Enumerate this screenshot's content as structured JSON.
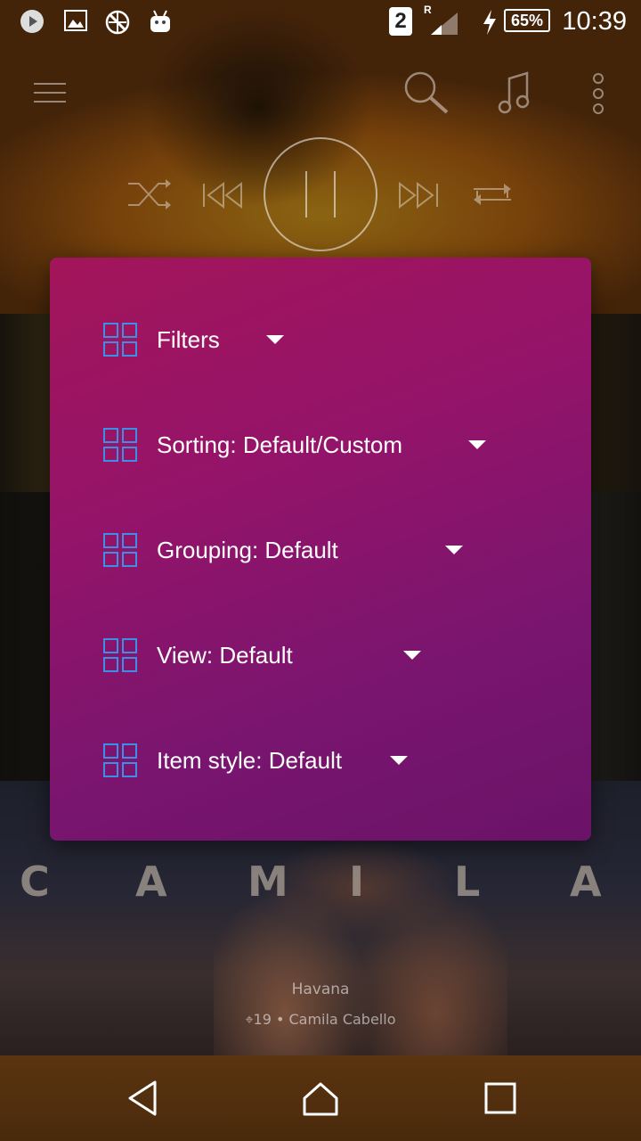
{
  "status_bar": {
    "icons": [
      "play-icon",
      "image-icon",
      "no-network-icon",
      "android-icon"
    ],
    "sim_slot": "2",
    "roaming": "R",
    "battery_percent": "65%",
    "time": "10:39"
  },
  "toolbar": {
    "icons": [
      "menu-icon",
      "search-icon",
      "music-note-icon",
      "more-vert-icon"
    ]
  },
  "player": {
    "icons": [
      "shuffle-icon",
      "previous-icon",
      "pause-icon",
      "next-icon",
      "repeat-icon"
    ]
  },
  "menu": {
    "items": [
      {
        "label": "Filters",
        "icon": "grid-icon"
      },
      {
        "label": "Sorting: Default/Custom",
        "icon": "grid-icon"
      },
      {
        "label": "Grouping: Default",
        "icon": "grid-icon"
      },
      {
        "label": "View: Default",
        "icon": "grid-icon"
      },
      {
        "label": "Item style: Default",
        "icon": "grid-icon"
      }
    ]
  },
  "album": {
    "cover_text": [
      "C",
      "A",
      "M",
      "I",
      "L",
      "A"
    ],
    "track_title": "Havana",
    "track_meta": "⌖19 • Camila Cabello"
  },
  "nav_bar": {
    "icons": [
      "back-icon",
      "home-icon",
      "recents-icon"
    ]
  },
  "colors": {
    "menu_gradient_start": "#a3155a",
    "menu_gradient_end": "#6a1368",
    "grid_icon_color": "#3b8fe6"
  }
}
